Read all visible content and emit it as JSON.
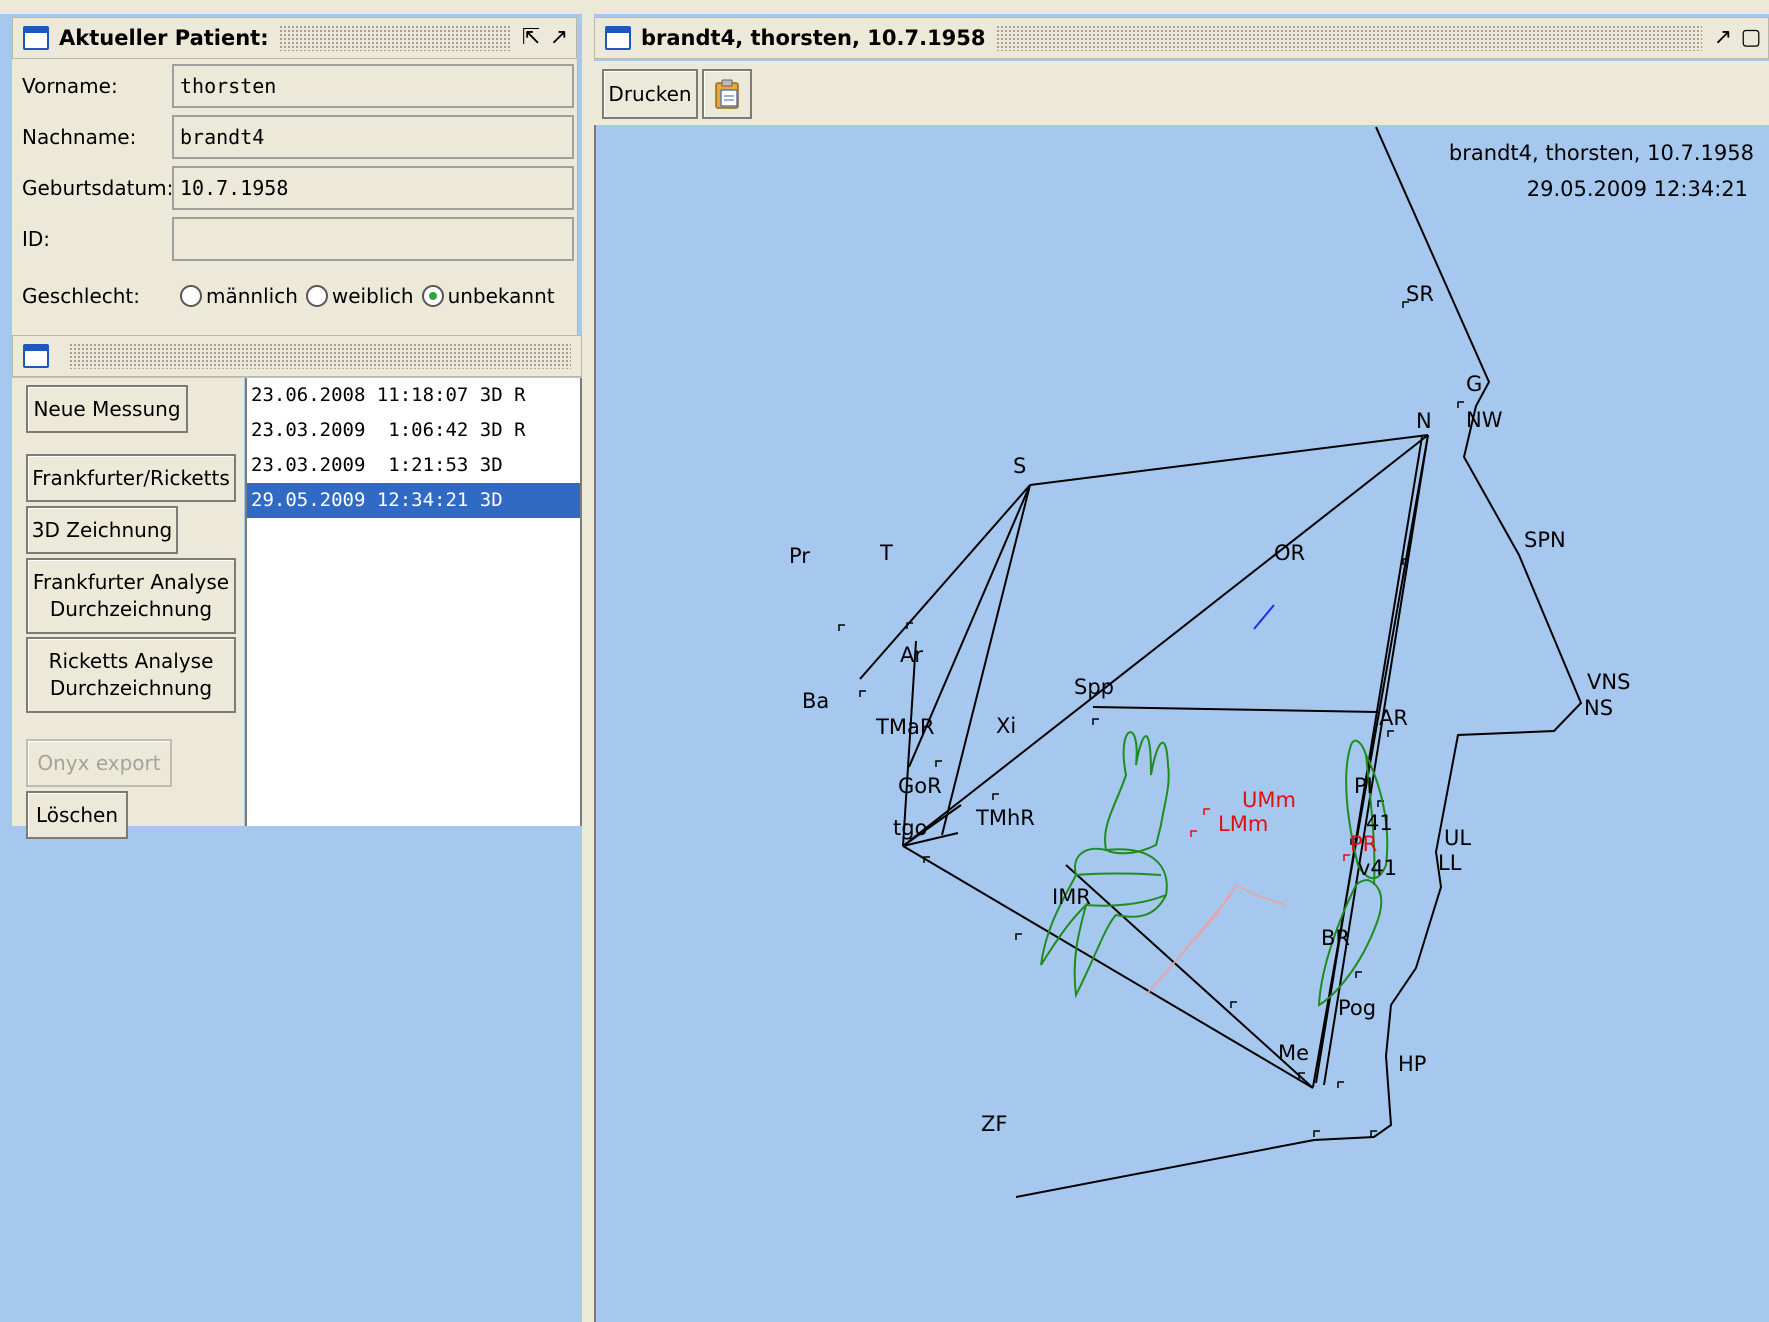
{
  "patient_panel": {
    "title": "Aktueller Patient:",
    "fields": [
      {
        "label": "Vorname:",
        "value": "thorsten"
      },
      {
        "label": "Nachname:",
        "value": "brandt4"
      },
      {
        "label": "Geburtsdatum:",
        "value": "10.7.1958"
      },
      {
        "label": "ID:",
        "value": ""
      }
    ],
    "gender_label": "Geschlecht:",
    "gender_options": [
      "männlich",
      "weiblich",
      "unbekannt"
    ],
    "gender_selected": "unbekannt"
  },
  "measurement_panel": {
    "buttons": {
      "new_measurement": "Neue Messung",
      "frankfurter_ricketts": "Frankfurter/Ricketts",
      "drawing_3d": "3D Zeichnung",
      "frankfurter_analysis_1": "Frankfurter Analyse",
      "frankfurter_analysis_2": "Durchzeichnung",
      "ricketts_analysis_1": "Ricketts Analyse",
      "ricketts_analysis_2": "Durchzeichnung",
      "onyx_export": "Onyx export",
      "delete": "Löschen"
    },
    "measurements": [
      "23.06.2008 11:18:07 3D R",
      "23.03.2009  1:06:42 3D R",
      "23.03.2009  1:21:53 3D",
      "29.05.2009 12:34:21 3D"
    ],
    "selected_index": 3
  },
  "drawing_panel": {
    "title": "brandt4, thorsten, 10.7.1958",
    "print_label": "Drucken",
    "clipboard_icon": "clipboard-icon",
    "header_name": "brandt4, thorsten, 10.7.1958",
    "header_date": "29.05.2009 12:34:21",
    "landmarks": {
      "SR": "SR",
      "G": "G",
      "N": "N",
      "NW": "NW",
      "S": "S",
      "SPN": "SPN",
      "OR": "OR",
      "Pr": "Pr",
      "T": "T",
      "Ar": "Ar",
      "Ba": "Ba",
      "Spp": "Spp",
      "VNS": "VNS",
      "NS": "NS",
      "AR": "AR",
      "TMaR": "TMaR",
      "Xi": "Xi",
      "UMm": "UMm",
      "LMm": "LMm",
      "GoR": "GoR",
      "PI": "PI",
      "PR": "PR",
      "v41": "v41",
      "tgo": "tgo",
      "TMhR": "TMhR",
      "UL": "UL",
      "LL": "LL",
      "IMR": "IMR",
      "BR": "BR",
      "Pog": "Pog",
      "Me": "Me",
      "HP": "HP",
      "ZF": "ZF",
      "r41": "41"
    }
  },
  "colors": {
    "bg": "#a6c8ee",
    "panel": "#ece9d8",
    "selection": "#316ac5",
    "tooth": "#1e8c1e",
    "red": "#e01010"
  }
}
